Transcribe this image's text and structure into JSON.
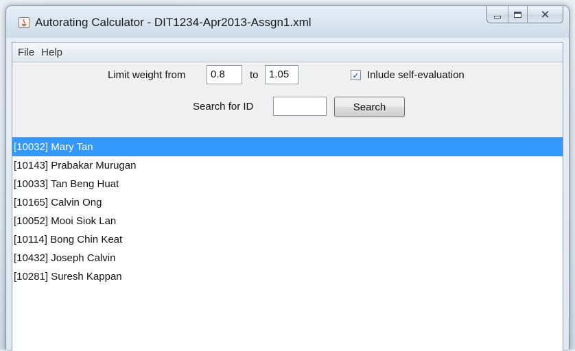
{
  "window": {
    "title": "Autorating Calculator - DIT1234-Apr2013-Assgn1.xml",
    "icon": "java-app-icon",
    "caption_buttons": [
      "minimize-icon",
      "maximize-icon",
      "close-icon"
    ]
  },
  "menu": {
    "items": [
      "File",
      "Help"
    ]
  },
  "controls": {
    "limit_label": "Limit weight from",
    "from_value": "0.8",
    "to_label": "to",
    "to_value": "1.05",
    "self_eval_checked": true,
    "self_eval_label": "Inlude self-evaluation",
    "search_label": "Search for ID",
    "search_value": "",
    "search_button": "Search"
  },
  "list": {
    "selected_index": 0,
    "items": [
      "[10032] Mary Tan",
      "[10143] Prabakar Murugan",
      "[10033] Tan Beng Huat",
      "[10165] Calvin Ong",
      "[10052] Mooi Siok Lan",
      "[10114] Bong Chin Keat",
      "[10432] Joseph Calvin",
      "[10281] Suresh Kappan"
    ]
  },
  "colors": {
    "selection": "#3399ff",
    "check": "#2b4f86"
  }
}
